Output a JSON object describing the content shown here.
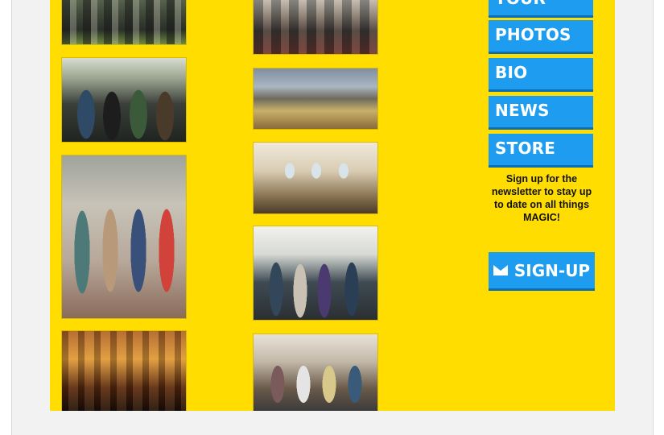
{
  "nav": {
    "items": [
      {
        "label": "TOUR"
      },
      {
        "label": "PHOTOS"
      },
      {
        "label": "BIO"
      },
      {
        "label": "NEWS"
      },
      {
        "label": "STORE"
      }
    ]
  },
  "newsletter": {
    "text": "Sign up for the newsletter to stay up to date on all things MAGIC!",
    "button_label": "SIGN-UP",
    "button_icon": "mail-icon"
  },
  "gallery": {
    "photos": [
      {
        "name": "band-photo-1"
      },
      {
        "name": "band-photo-2"
      },
      {
        "name": "band-photo-3"
      },
      {
        "name": "band-photo-4"
      },
      {
        "name": "band-photo-5"
      },
      {
        "name": "band-photo-6"
      },
      {
        "name": "band-photo-7"
      },
      {
        "name": "band-photo-8"
      },
      {
        "name": "band-photo-9"
      }
    ]
  },
  "colors": {
    "background": "#ffdd00",
    "button": "#1e9df0",
    "button_shadow": "#0a6fb4",
    "text_dark": "#111111"
  }
}
